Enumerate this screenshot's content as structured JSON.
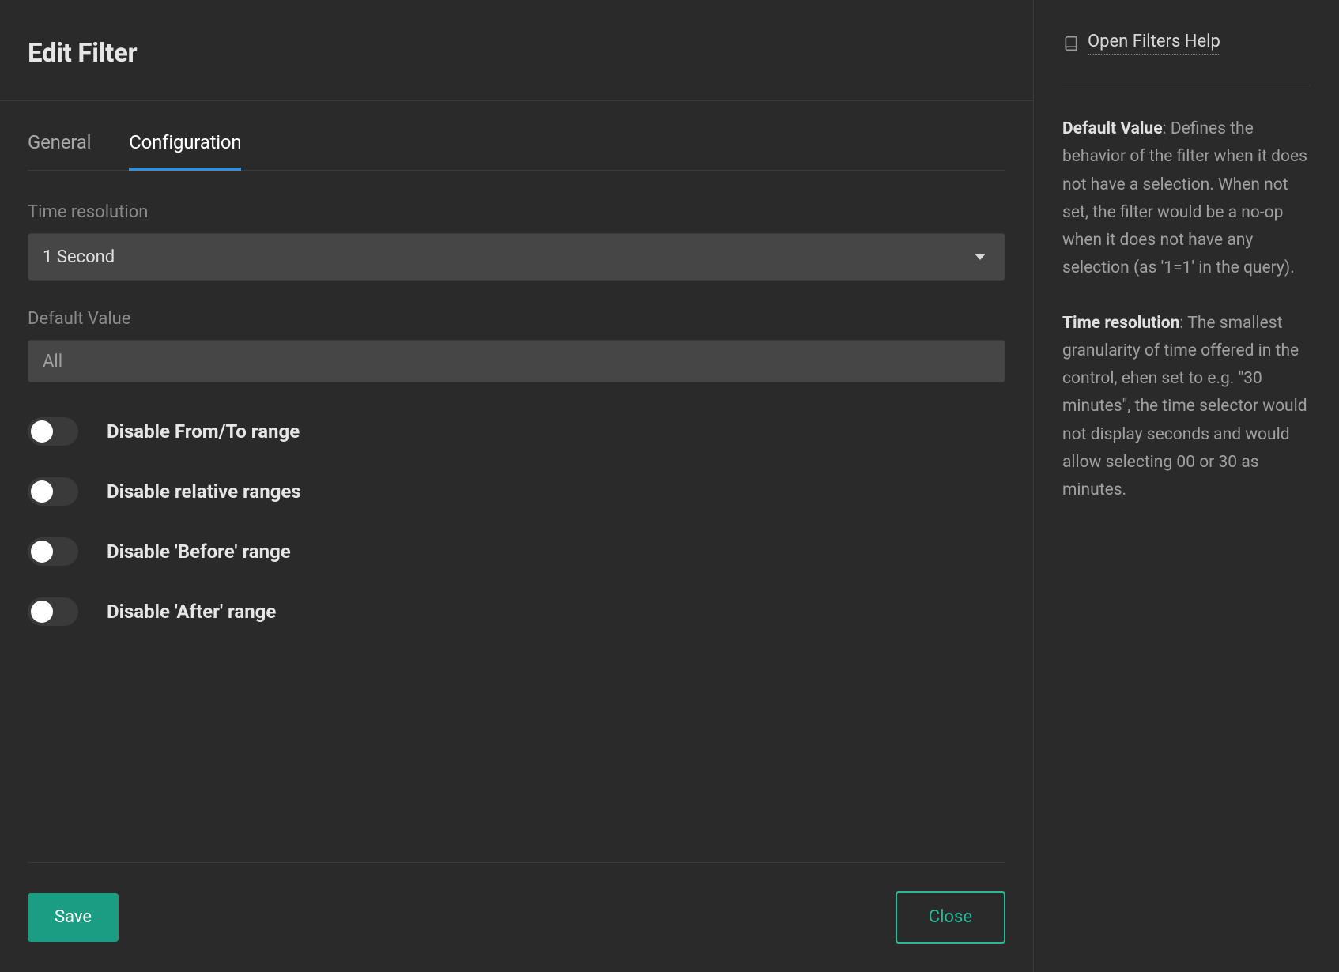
{
  "header": {
    "title": "Edit Filter"
  },
  "tabs": {
    "general": "General",
    "configuration": "Configuration"
  },
  "form": {
    "time_resolution_label": "Time resolution",
    "time_resolution_value": "1 Second",
    "default_value_label": "Default Value",
    "default_value_placeholder": "All"
  },
  "toggles": {
    "disable_from_to": "Disable From/To range",
    "disable_relative": "Disable relative ranges",
    "disable_before": "Disable 'Before' range",
    "disable_after": "Disable 'After' range"
  },
  "actions": {
    "save": "Save",
    "close": "Close"
  },
  "help": {
    "link_label": "Open Filters Help",
    "para1_strong": "Default Value",
    "para1_body": ": Defines the behavior of the filter when it does not have a selection. When not set, the filter would be a no-op when it does not have any selection (as '1=1' in the query).",
    "para2_strong": "Time resolution",
    "para2_body": ": The smallest granularity of time offered in the control, ehen set to e.g. \"30 minutes\", the time selector would not display seconds and would allow selecting 00 or 30 as minutes."
  }
}
